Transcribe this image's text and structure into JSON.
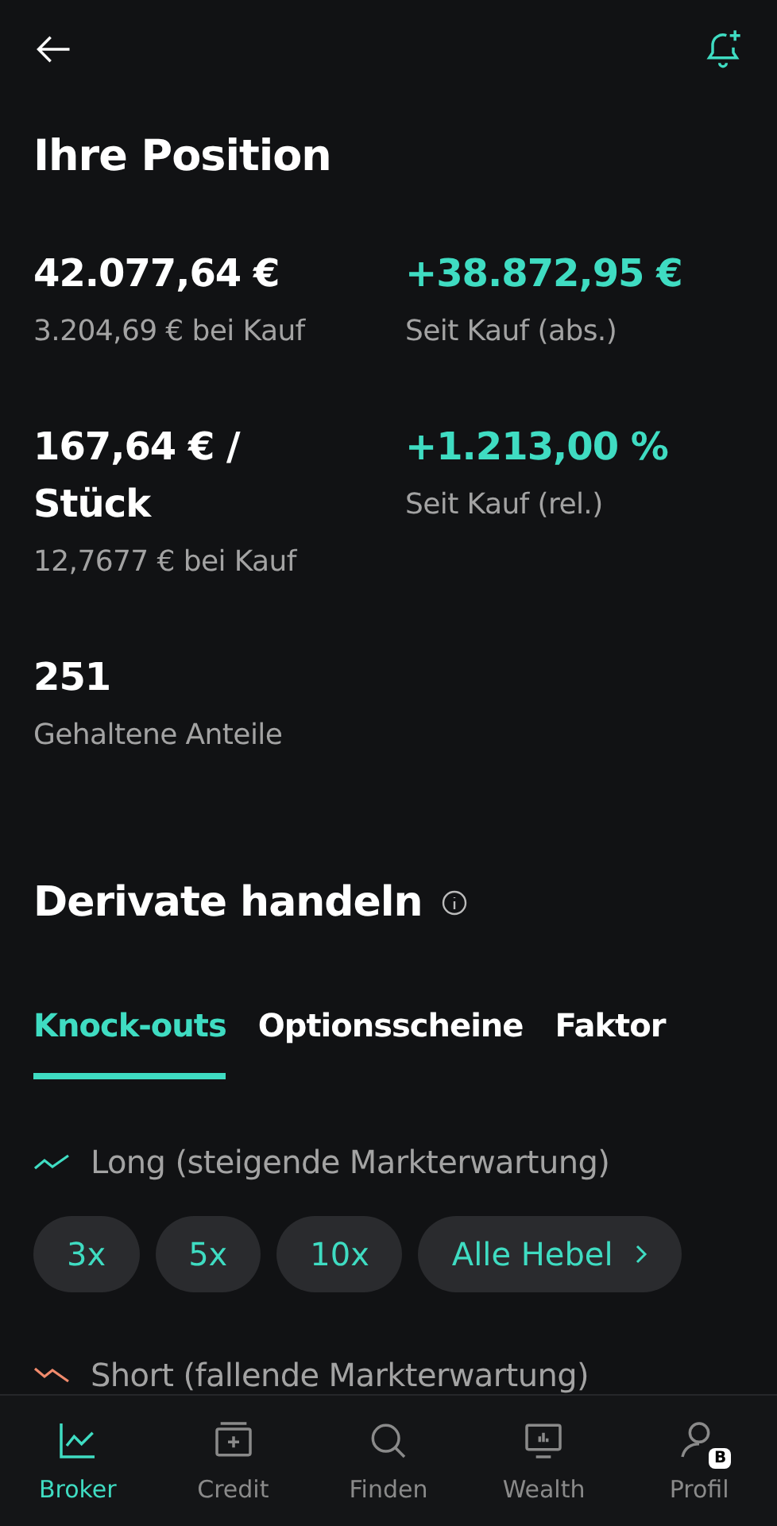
{
  "title": "Ihre Position",
  "stats": [
    {
      "value": "42.077,64 €",
      "caption": "3.204,69 € bei Kauf",
      "kind": "plain"
    },
    {
      "value": "+38.872,95 €",
      "caption": "Seit Kauf (abs.)",
      "kind": "gain"
    },
    {
      "value": "167,64 € / Stück",
      "caption": "12,7677 € bei Kauf",
      "kind": "plain"
    },
    {
      "value": "+1.213,00 %",
      "caption": "Seit Kauf (rel.)",
      "kind": "gain"
    },
    {
      "value": "251",
      "caption": "Gehaltene Anteile",
      "kind": "plain"
    }
  ],
  "section_title": "Derivate handeln",
  "tabs": [
    {
      "label": "Knock-outs",
      "selected": true
    },
    {
      "label": "Optionsscheine",
      "selected": false
    },
    {
      "label": "Faktor",
      "selected": false
    }
  ],
  "groups": [
    {
      "kind": "long",
      "label": "Long (steigende Markterwartung)",
      "chips": [
        {
          "label": "3x",
          "kind": "lever"
        },
        {
          "label": "5x",
          "kind": "lever"
        },
        {
          "label": "10x",
          "kind": "lever"
        },
        {
          "label": "Alle Hebel",
          "kind": "more"
        }
      ]
    },
    {
      "kind": "short",
      "label": "Short (fallende Markterwartung)"
    }
  ],
  "nav": [
    {
      "label": "Broker",
      "selected": true
    },
    {
      "label": "Credit",
      "selected": false
    },
    {
      "label": "Finden",
      "selected": false
    },
    {
      "label": "Wealth",
      "selected": false
    },
    {
      "label": "Profil",
      "selected": false,
      "badge": "B"
    }
  ]
}
